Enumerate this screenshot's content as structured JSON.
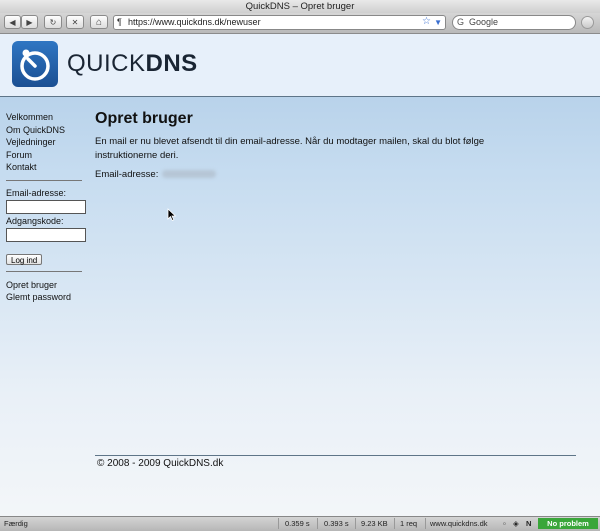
{
  "window": {
    "title": "QuickDNS – Opret bruger"
  },
  "toolbar": {
    "back_icon": "◀",
    "forward_icon": "▶",
    "reload_icon": "↻",
    "stop_icon": "✕",
    "home_icon": "⌂",
    "url": "https://www.quickdns.dk/newuser",
    "search_placeholder": "Google",
    "site_icon": "¶",
    "bookmark_icon": "☆",
    "dropdown_icon": "▼",
    "search_engine_icon": "G"
  },
  "logo": {
    "part1": "QUICK",
    "part2": "DNS"
  },
  "sidebar": {
    "nav": [
      "Velkommen",
      "Om QuickDNS",
      "Vejledninger",
      "Forum",
      "Kontakt"
    ],
    "email_label": "Email-adresse:",
    "password_label": "Adgangskode:",
    "login_button": "Log ind",
    "links": [
      "Opret bruger",
      "Glemt password"
    ]
  },
  "main": {
    "heading": "Opret bruger",
    "message": "En mail er nu blevet afsendt til din email-adresse. Når du modtager mailen, skal du blot følge instruktionerne deri.",
    "email_label": "Email-adresse:"
  },
  "footer": {
    "copyright": "© 2008 - 2009 QuickDNS.dk"
  },
  "statusbar": {
    "status": "Færdig",
    "time1": "0.359 s",
    "time2": "0.393 s",
    "size": "9.23 KB",
    "requests": "1 req",
    "host": "www.quickdns.dk",
    "badge": "No problem",
    "badge_color": "#3aa63a"
  }
}
